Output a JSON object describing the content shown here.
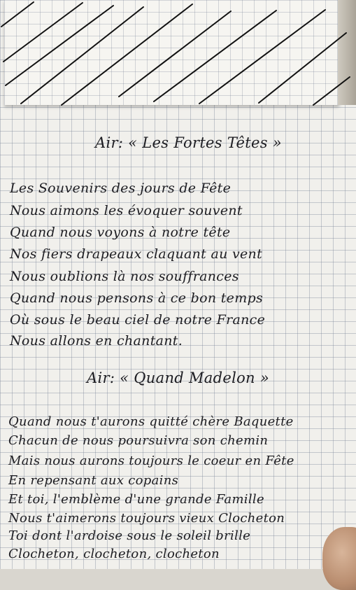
{
  "title1": "Air: « Les Fortes Têtes »",
  "verse1": [
    "Les Souvenirs des jours de Fête",
    "Nous aimons les évoquer souvent",
    "Quand nous voyons à notre tête",
    "Nos fiers drapeaux claquant au vent",
    "Nous oublions là nos souffrances",
    "Quand nous pensons à ce bon temps",
    "Où sous le beau ciel de notre France",
    "Nous allons en chantant."
  ],
  "title2": "Air: « Quand Madelon »",
  "verse2": [
    "Quand nous t'aurons quitté chère Baquette",
    "Chacun de nous poursuivra son chemin",
    "Mais nous aurons toujours le coeur en Fête",
    "En repensant aux copains",
    "Et toi, l'emblème d'une grande Famille",
    "Nous t'aimerons toujours vieux Clocheton",
    "Toi dont l'ardoise sous le soleil brille",
    "Clocheton, clocheton, clocheton"
  ]
}
